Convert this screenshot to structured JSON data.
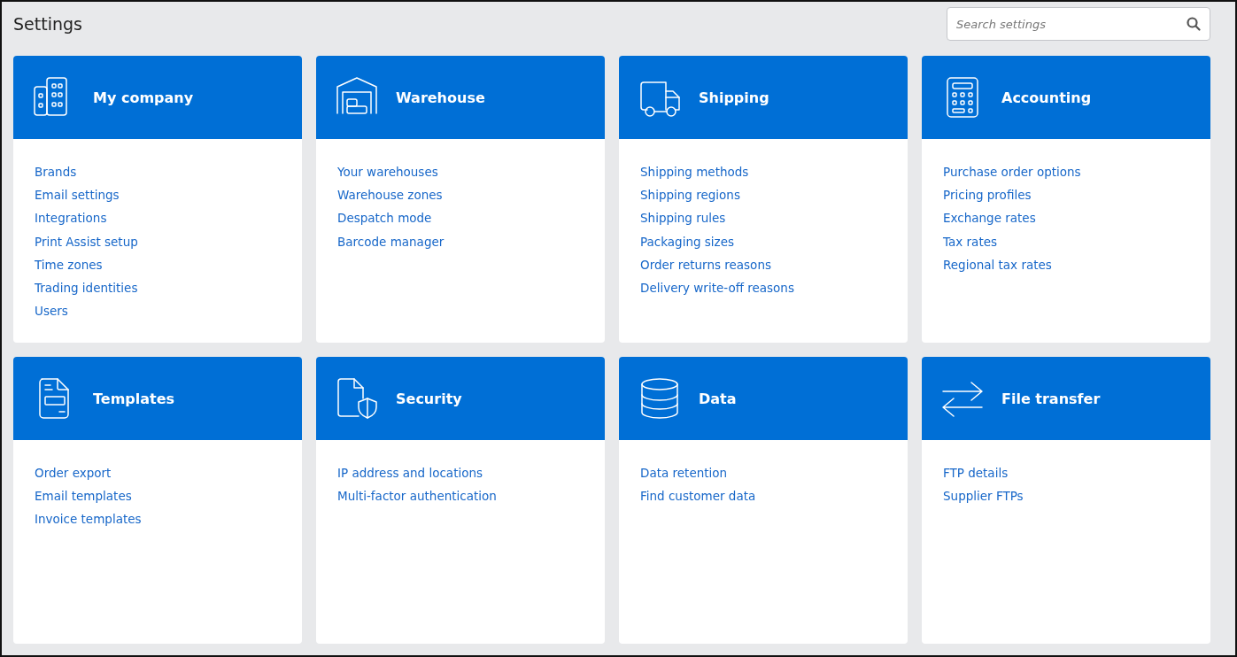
{
  "page_title": "Settings",
  "search": {
    "placeholder": "Search settings"
  },
  "cards": [
    {
      "kind": "buildings",
      "title": "My company",
      "links": [
        "Brands",
        "Email settings",
        "Integrations",
        "Print Assist setup",
        "Time zones",
        "Trading identities",
        "Users"
      ]
    },
    {
      "kind": "warehouse",
      "title": "Warehouse",
      "links": [
        "Your warehouses",
        "Warehouse zones",
        "Despatch mode",
        "Barcode manager"
      ]
    },
    {
      "kind": "truck",
      "title": "Shipping",
      "links": [
        "Shipping methods",
        "Shipping regions",
        "Shipping rules",
        "Packaging sizes",
        "Order returns reasons",
        "Delivery write-off reasons"
      ]
    },
    {
      "kind": "calculator",
      "title": "Accounting",
      "links": [
        "Purchase order options",
        "Pricing profiles",
        "Exchange rates",
        "Tax rates",
        "Regional tax rates"
      ]
    },
    {
      "kind": "document",
      "title": "Templates",
      "links": [
        "Order export",
        "Email templates",
        "Invoice templates"
      ]
    },
    {
      "kind": "shield",
      "title": "Security",
      "links": [
        "IP address and locations",
        "Multi-factor authentication"
      ]
    },
    {
      "kind": "database",
      "title": "Data",
      "links": [
        "Data retention",
        "Find customer data"
      ]
    },
    {
      "kind": "arrows",
      "title": "File transfer",
      "links": [
        "FTP details",
        "Supplier FTPs"
      ]
    }
  ]
}
